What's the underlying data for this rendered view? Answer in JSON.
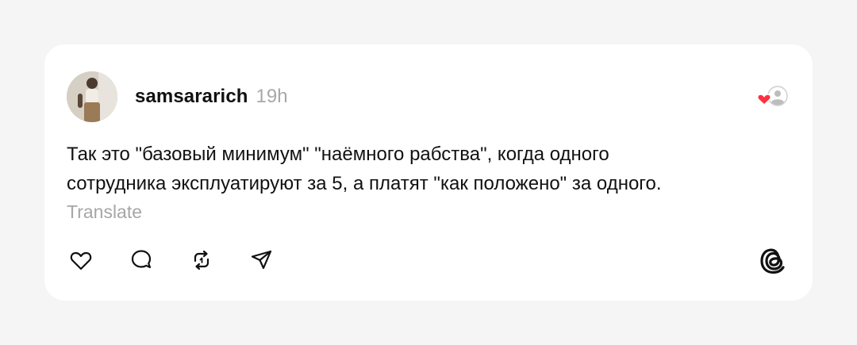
{
  "post": {
    "username": "samsararich",
    "time": "19h",
    "text_line1": "Так это \"базовый минимум\" \"наёмного рабства\", когда одного",
    "text_line2": "сотрудника эксплуатируют за 5, а платят \"как положено\" за одного.",
    "translate_label": "Translate"
  },
  "actions": {
    "like_icon": "heart-icon",
    "reply_icon": "comment-icon",
    "repost_icon": "repost-icon",
    "share_icon": "send-icon"
  },
  "brand": {
    "logo": "threads-logo",
    "heart_color": "#ff3040"
  }
}
